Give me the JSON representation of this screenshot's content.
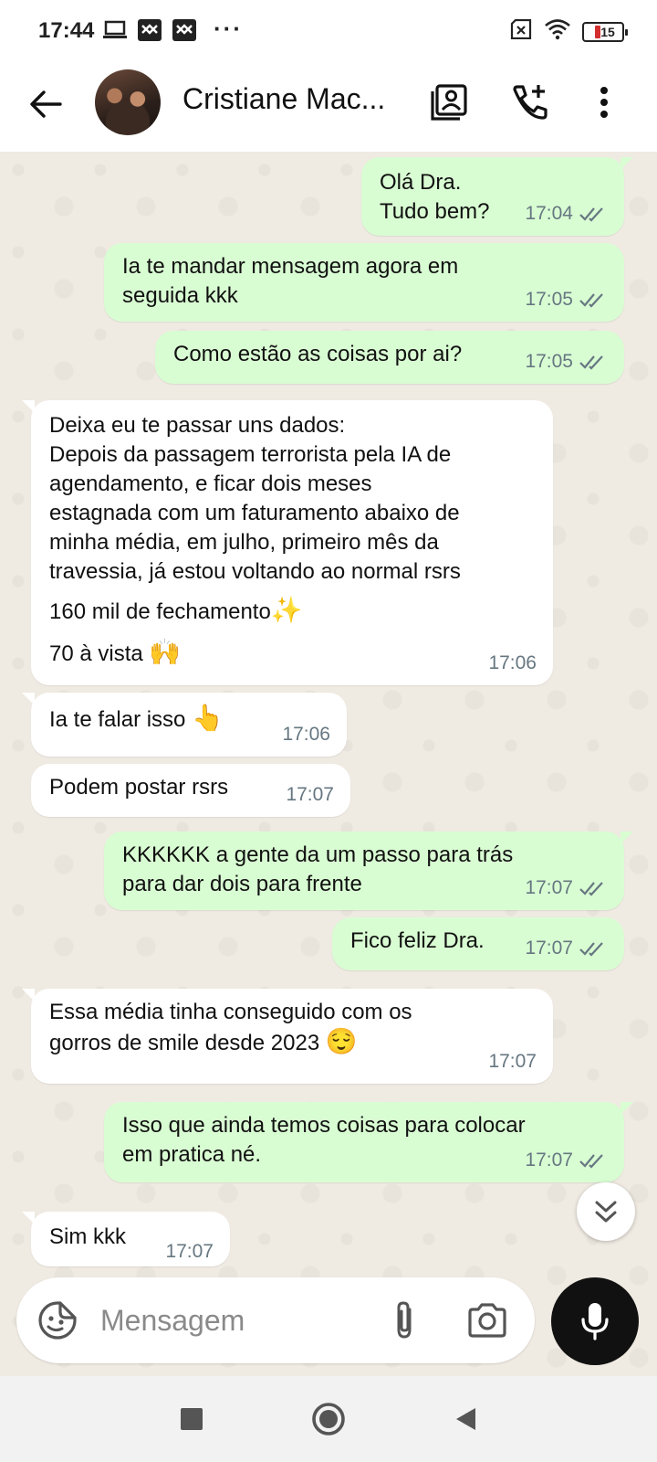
{
  "status_bar": {
    "time": "17:44",
    "battery": "15",
    "icons_left": [
      "laptop-icon",
      "app-notification-icon",
      "app-notification-icon"
    ],
    "icons_right": [
      "no-sim-icon",
      "wifi-icon",
      "battery-icon"
    ]
  },
  "header": {
    "contact_name": "Cristiane Mac...",
    "icons": [
      "back-arrow-icon",
      "contact-card-icon",
      "add-call-icon",
      "more-vertical-icon"
    ]
  },
  "messages": [
    {
      "dir": "out",
      "text": "Olá Dra.\nTudo bem?",
      "time": "17:04",
      "status": "read"
    },
    {
      "dir": "out",
      "text": "Ia te mandar mensagem agora em\nseguida kkk",
      "time": "17:05",
      "status": "read"
    },
    {
      "dir": "out",
      "text": "Como estão as coisas por ai?",
      "time": "17:05",
      "status": "read"
    },
    {
      "dir": "in",
      "text": "Deixa eu te passar uns dados:\nDepois da passagem terrorista pela IA de\nagendamento, e ficar dois meses\nestagnada com um faturamento abaixo de\nminha média, em julho, primeiro mês da\ntravessia, já estou voltando ao normal rsrs",
      "text2": "160 mil de fechamento",
      "emoji2": "✨",
      "text3": "70 à vista",
      "emoji3": "🙌",
      "time": "17:06"
    },
    {
      "dir": "in",
      "text": "Ia te falar isso",
      "emoji": "👆",
      "time": "17:06"
    },
    {
      "dir": "in",
      "text": "Podem postar rsrs",
      "time": "17:07"
    },
    {
      "dir": "out",
      "text": "KKKKKK a gente da um passo para trás\npara dar dois para frente",
      "time": "17:07",
      "status": "read"
    },
    {
      "dir": "out",
      "text": "Fico feliz Dra.",
      "time": "17:07",
      "status": "read"
    },
    {
      "dir": "in",
      "text": "Essa média tinha conseguido com os\ngorros de smile desde 2023",
      "emoji": "😌",
      "time": "17:07"
    },
    {
      "dir": "out",
      "text": "Isso que ainda temos coisas para colocar\nem pratica né.",
      "time": "17:07",
      "status": "read"
    },
    {
      "dir": "in",
      "text": "Sim kkk",
      "time": "17:07"
    }
  ],
  "composer": {
    "placeholder": "Mensagem",
    "icons": [
      "sticker-icon",
      "paperclip-icon",
      "camera-icon",
      "mic-icon"
    ]
  },
  "nav": {
    "icons": [
      "recents-square-icon",
      "home-circle-icon",
      "back-triangle-icon"
    ]
  },
  "colors": {
    "outgoing_bubble": "#d9fdd3",
    "incoming_bubble": "#ffffff",
    "chat_background": "#efeae2",
    "read_ticks": "#667781",
    "mic_button": "#111111"
  }
}
